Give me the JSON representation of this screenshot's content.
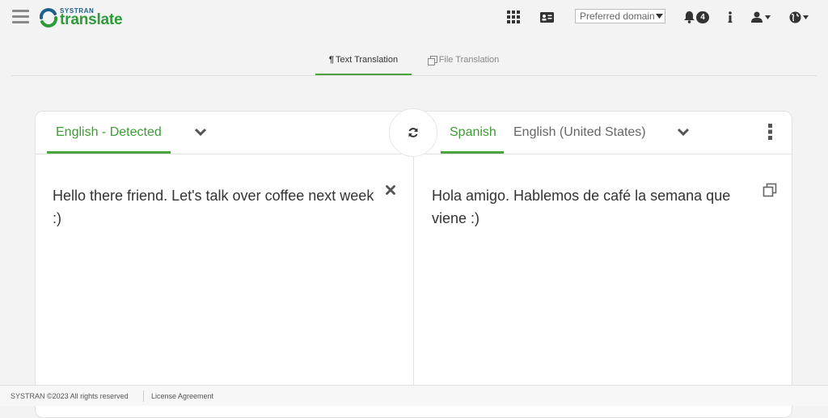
{
  "header": {
    "logo_small": "SYSTRAN",
    "logo_big": "translate",
    "domain_placeholder": "Preferred domain",
    "notification_count": "4"
  },
  "tabs": [
    {
      "label": "Text Translation",
      "icon": "paragraph-icon",
      "active": true
    },
    {
      "label": "File Translation",
      "icon": "file-copy-icon",
      "active": false
    }
  ],
  "source": {
    "language_label": "English - Detected",
    "text": "Hello there friend. Let's talk over coffee next week :)"
  },
  "target": {
    "language_active": "Spanish",
    "language_other": "English (United States)",
    "text": "Hola amigo. Hablemos de café la semana que viene :)"
  },
  "footer": {
    "copyright": "SYSTRAN ©2023 All rights reserved",
    "license": "License Agreement"
  },
  "colors": {
    "accent_green": "#4aa33c",
    "brand_blue": "#1d5f8c"
  }
}
